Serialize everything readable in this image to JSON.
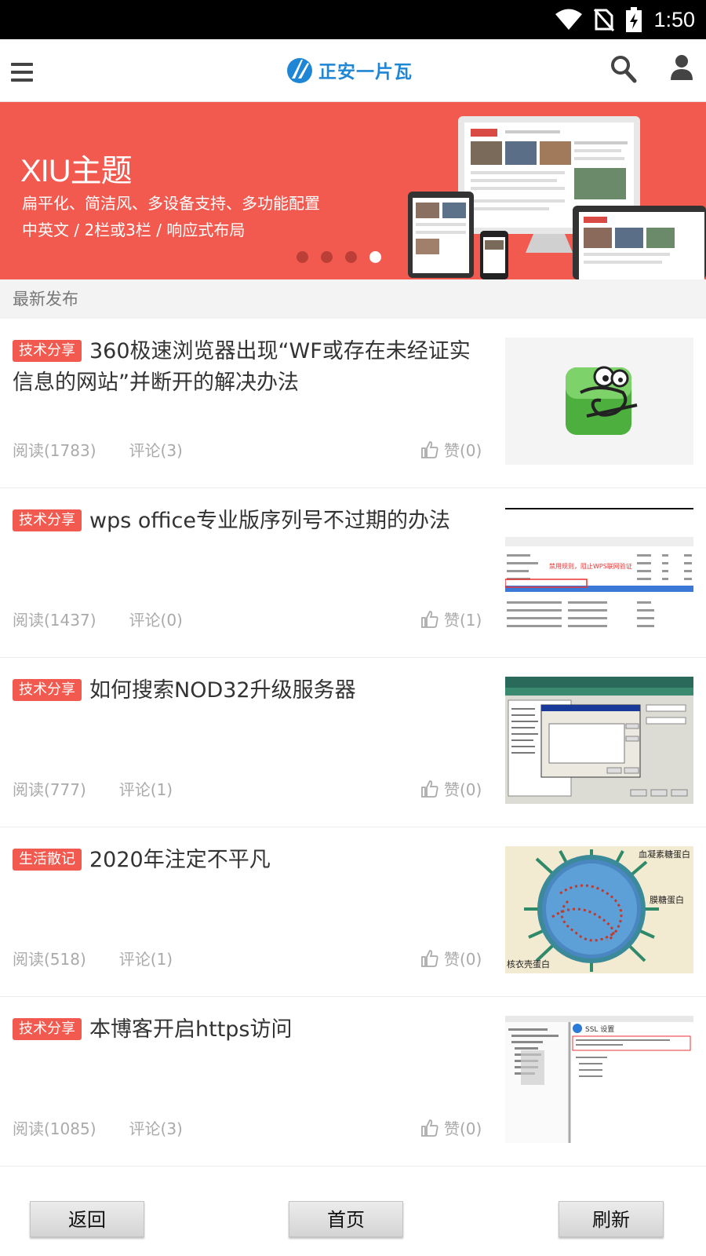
{
  "status_bar": {
    "time": "1:50"
  },
  "header": {
    "logo_text": "正安一片瓦"
  },
  "banner": {
    "title": "XIU主题",
    "line1": "扁平化、简洁风、多设备支持、多功能配置",
    "line2": "中英文 / 2栏或3栏 / 响应式布局",
    "active_slide": 4,
    "slide_count": 4
  },
  "section_title": "最新发布",
  "articles": [
    {
      "category": "技术分享",
      "title": "360极速浏览器出现“WF或存在未经证实信息的网站”并断开的解决办法",
      "reads": "阅读(1783)",
      "comments": "评论(3)",
      "likes": "赞(0)",
      "thumb": "camel-app-icon"
    },
    {
      "category": "技术分享",
      "title": "wps office专业版序列号不过期的办法",
      "reads": "阅读(1437)",
      "comments": "评论(0)",
      "likes": "赞(1)",
      "thumb": "firewall-rules-screenshot",
      "thumb_text": "禁用规则，阻止WPS联网验证"
    },
    {
      "category": "技术分享",
      "title": "如何搜索NOD32升级服务器",
      "reads": "阅读(777)",
      "comments": "评论(1)",
      "likes": "赞(0)",
      "thumb": "nod32-settings-screenshot"
    },
    {
      "category": "生活散记",
      "title": "2020年注定不平凡",
      "reads": "阅读(518)",
      "comments": "评论(1)",
      "likes": "赞(0)",
      "thumb": "virus-diagram",
      "thumb_labels": [
        "血凝素糖蛋白",
        "膜糖蛋白",
        "核衣壳蛋白"
      ]
    },
    {
      "category": "技术分享",
      "title": "本博客开启https访问",
      "reads": "阅读(1085)",
      "comments": "评论(3)",
      "likes": "赞(0)",
      "thumb": "iis-ssl-screenshot",
      "thumb_text": "SSL 设置"
    }
  ],
  "bottom_buttons": {
    "back": "返回",
    "home": "首页",
    "refresh": "刷新"
  },
  "colors": {
    "accent": "#f25a50",
    "brand_blue": "#1f86d6"
  }
}
